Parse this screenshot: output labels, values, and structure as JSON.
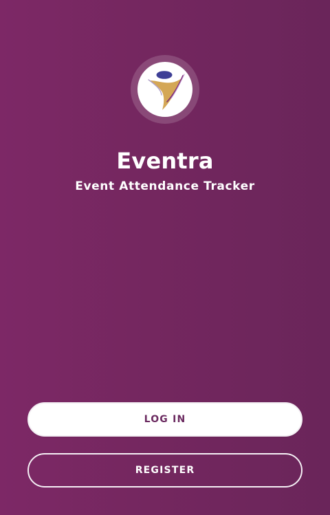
{
  "app": {
    "name": "Eventra",
    "tagline": "Event Attendance Tracker",
    "logo_icon": "eventra-logo-icon"
  },
  "buttons": {
    "login_label": "LOG IN",
    "register_label": "REGISTER"
  },
  "colors": {
    "background": "#74275F",
    "primary_text": "#FFFFFF",
    "login_button_bg": "#FFFFFF",
    "login_button_text": "#6B2A60",
    "logo_gold": "#D4A756",
    "logo_blue": "#3E3F96"
  }
}
